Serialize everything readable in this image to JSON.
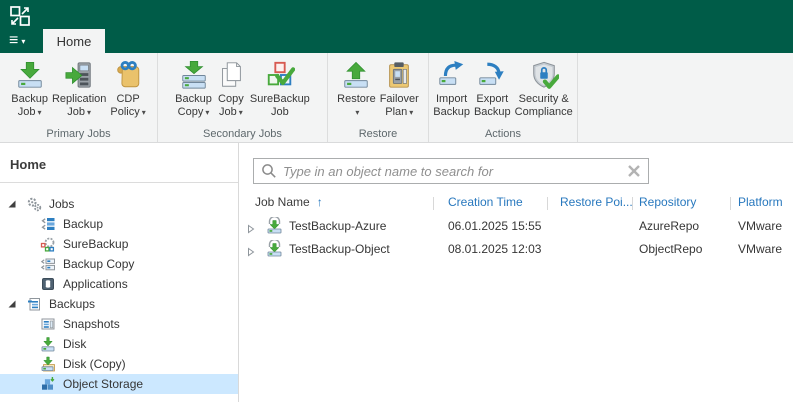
{
  "titlebar": {
    "tab": "Home"
  },
  "glyphs": {
    "menu": "≡",
    "dropdown": "▾",
    "sort_asc": "↑"
  },
  "colors": {
    "titlebar_green": "#005c48",
    "header_blue": "#2878be",
    "selection_blue": "#cce8ff",
    "accent_green": "#48a93c"
  },
  "ribbon": {
    "groups": [
      {
        "label": "Primary Jobs",
        "buttons": [
          {
            "line1": "Backup",
            "line2": "Job",
            "dropdown": true,
            "icon": "backup-job"
          },
          {
            "line1": "Replication",
            "line2": "Job",
            "dropdown": true,
            "icon": "replication-job"
          },
          {
            "line1": "CDP",
            "line2": "Policy",
            "dropdown": true,
            "icon": "cdp-policy"
          }
        ]
      },
      {
        "label": "Secondary Jobs",
        "buttons": [
          {
            "line1": "Backup",
            "line2": "Copy",
            "dropdown": true,
            "icon": "backup-copy"
          },
          {
            "line1": "Copy",
            "line2": "Job",
            "dropdown": true,
            "icon": "copy-job"
          },
          {
            "line1": "SureBackup",
            "line2": "Job",
            "dropdown": false,
            "icon": "surebackup-job"
          }
        ]
      },
      {
        "label": "Restore",
        "buttons": [
          {
            "line1": "Restore",
            "line2": "",
            "dropdown": true,
            "icon": "restore"
          },
          {
            "line1": "Failover",
            "line2": "Plan",
            "dropdown": true,
            "icon": "failover-plan"
          }
        ]
      },
      {
        "label": "Actions",
        "buttons": [
          {
            "line1": "Import",
            "line2": "Backup",
            "dropdown": false,
            "icon": "import-backup"
          },
          {
            "line1": "Export",
            "line2": "Backup",
            "dropdown": false,
            "icon": "export-backup"
          },
          {
            "line1": "Security &",
            "line2": "Compliance",
            "dropdown": false,
            "icon": "security-compliance"
          }
        ]
      }
    ]
  },
  "sidebar": {
    "header": "Home",
    "tree": [
      {
        "label": "Jobs",
        "level": 0,
        "expanded": true,
        "icon": "jobs"
      },
      {
        "label": "Backup",
        "level": 1,
        "icon": "backup"
      },
      {
        "label": "SureBackup",
        "level": 1,
        "icon": "surebackup"
      },
      {
        "label": "Backup Copy",
        "level": 1,
        "icon": "backup-copy"
      },
      {
        "label": "Applications",
        "level": 1,
        "icon": "applications"
      },
      {
        "label": "Backups",
        "level": 0,
        "expanded": true,
        "icon": "backups"
      },
      {
        "label": "Snapshots",
        "level": 1,
        "icon": "snapshots"
      },
      {
        "label": "Disk",
        "level": 1,
        "icon": "disk"
      },
      {
        "label": "Disk (Copy)",
        "level": 1,
        "icon": "disk-copy"
      },
      {
        "label": "Object Storage",
        "level": 1,
        "icon": "object-storage",
        "selected": true
      }
    ]
  },
  "main": {
    "search": {
      "placeholder": "Type in an object name to search for"
    },
    "table": {
      "columns": [
        {
          "label": "Job Name",
          "sorted": "asc"
        },
        {
          "label": "Creation Time"
        },
        {
          "label": "Restore Poi..."
        },
        {
          "label": "Repository"
        },
        {
          "label": "Platform"
        }
      ],
      "rows": [
        {
          "job_name": "TestBackup-Azure",
          "creation_time": "06.01.2025 15:55",
          "restore_points": "",
          "repository": "AzureRepo",
          "platform": "VMware"
        },
        {
          "job_name": "TestBackup-Object",
          "creation_time": "08.01.2025 12:03",
          "restore_points": "",
          "repository": "ObjectRepo",
          "platform": "VMware"
        }
      ]
    }
  }
}
